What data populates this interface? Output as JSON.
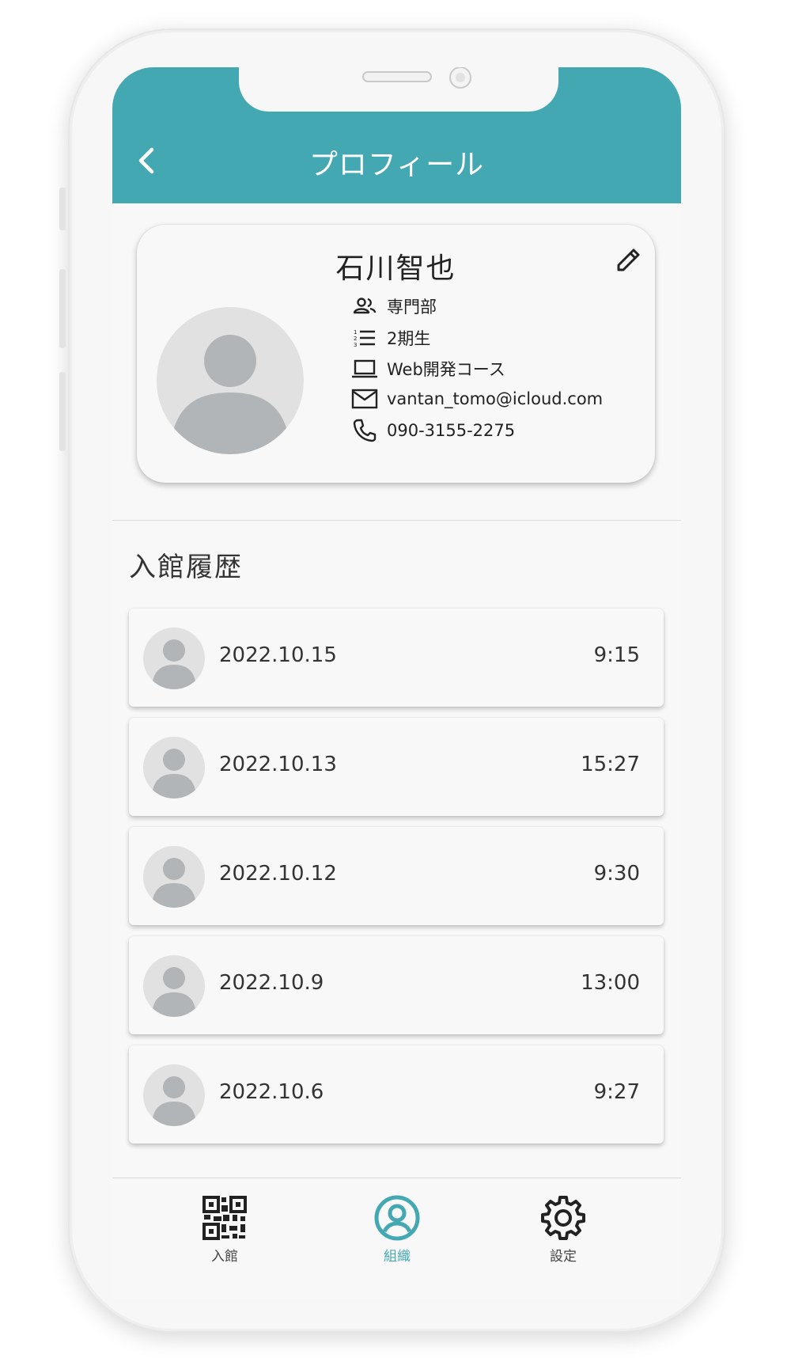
{
  "colors": {
    "accent": "#44a8b3",
    "card_background": "#f8f8f8",
    "avatar_background": "#e1e1e1",
    "avatar_figure": "#b1b5b8"
  },
  "header": {
    "title": "プロフィール",
    "back_icon": "chevron-left-icon"
  },
  "profile": {
    "name": "石川智也",
    "edit_icon": "pencil-icon",
    "details": [
      {
        "icon": "people-icon",
        "text": "専門部"
      },
      {
        "icon": "numbered-list-icon",
        "text": "2期生"
      },
      {
        "icon": "laptop-icon",
        "text": "Web開発コース"
      },
      {
        "icon": "mail-icon",
        "text": "vantan_tomo@icloud.com"
      },
      {
        "icon": "phone-icon",
        "text": "090-3155-2275"
      }
    ]
  },
  "history": {
    "title": "入館履歴",
    "entries": [
      {
        "date": "2022.10.15",
        "time": "9:15"
      },
      {
        "date": "2022.10.13",
        "time": "15:27"
      },
      {
        "date": "2022.10.12",
        "time": "9:30"
      },
      {
        "date": "2022.10.9",
        "time": "13:00"
      },
      {
        "date": "2022.10.6",
        "time": "9:27"
      }
    ]
  },
  "bottom_nav": {
    "items": [
      {
        "label": "入館",
        "icon": "qr-code-icon",
        "active": false
      },
      {
        "label": "組織",
        "icon": "account-circle-icon",
        "active": true
      },
      {
        "label": "設定",
        "icon": "gear-icon",
        "active": false
      }
    ]
  }
}
